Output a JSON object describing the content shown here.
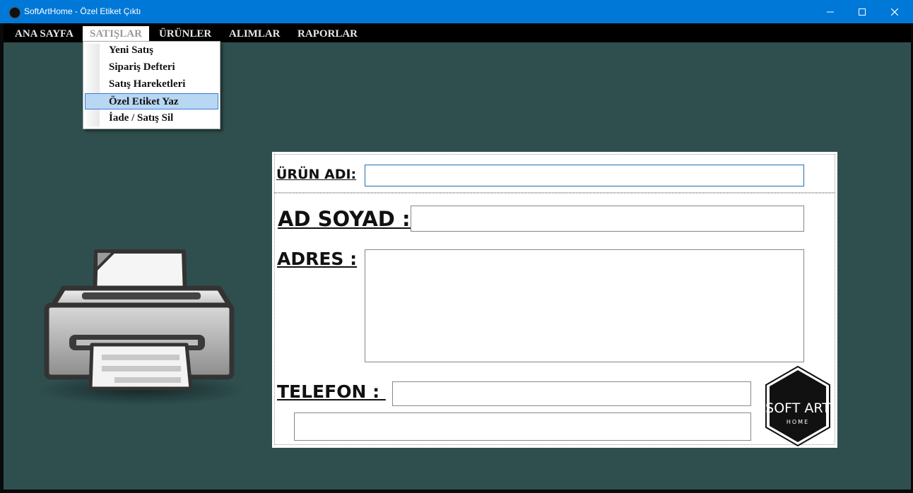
{
  "window": {
    "title": "SoftArtHome - Özel Etiket Çıktı"
  },
  "menu": {
    "items": [
      {
        "label": "ANA SAYFA"
      },
      {
        "label": "SATIŞLAR"
      },
      {
        "label": "ÜRÜNLER"
      },
      {
        "label": "ALIMLAR"
      },
      {
        "label": "RAPORLAR"
      }
    ],
    "active": "SATIŞLAR"
  },
  "dropdown": {
    "items": [
      {
        "label": "Yeni Satış"
      },
      {
        "label": "Sipariş Defteri"
      },
      {
        "label": "Satış Hareketleri"
      },
      {
        "label": "Özel Etiket Yaz"
      },
      {
        "label": "İade / Satış Sil"
      }
    ],
    "highlighted": "Özel Etiket Yaz"
  },
  "form": {
    "urun_adi_label": "ÜRÜN ADI:",
    "urun_adi_value": "",
    "ad_soyad_label": "AD SOYAD : ",
    "ad_soyad_value": "",
    "adres_label": "ADRES :",
    "adres_value": "",
    "telefon_label": "TELEFON : ",
    "telefon_value": "",
    "extra_value": ""
  },
  "logo": {
    "line1": "SOFT ART",
    "line2": "HOME"
  },
  "colors": {
    "titlebar": "#0078d7",
    "background": "#2f4f4f",
    "menubar": "#000000",
    "highlight": "#b8d7f3"
  }
}
